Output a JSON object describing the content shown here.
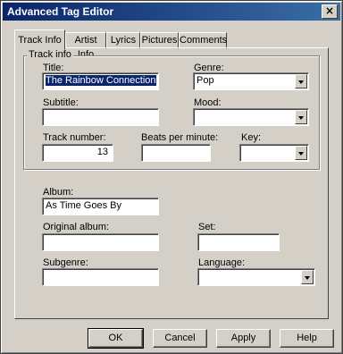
{
  "window": {
    "title": "Advanced Tag Editor",
    "close_glyph": "×"
  },
  "tabs": [
    {
      "label": "Track Info",
      "active": true
    },
    {
      "label": "Artist Info",
      "active": false
    },
    {
      "label": "Lyrics",
      "active": false
    },
    {
      "label": "Pictures",
      "active": false
    },
    {
      "label": "Comments",
      "active": false
    }
  ],
  "track_info_group": {
    "label": "Track info",
    "title": {
      "label": "Title:",
      "value": "The Rainbow Connection"
    },
    "genre": {
      "label": "Genre:",
      "value": "Pop"
    },
    "subtitle": {
      "label": "Subtitle:",
      "value": ""
    },
    "mood": {
      "label": "Mood:",
      "value": ""
    },
    "track_number": {
      "label": "Track number:",
      "value": "13"
    },
    "bpm": {
      "label": "Beats per minute:",
      "value": ""
    },
    "key": {
      "label": "Key:",
      "value": ""
    }
  },
  "album_section": {
    "album": {
      "label": "Album:",
      "value": "As Time Goes By"
    },
    "original_album": {
      "label": "Original album:",
      "value": ""
    },
    "set": {
      "label": "Set:",
      "value": ""
    },
    "subgenre": {
      "label": "Subgenre:",
      "value": ""
    },
    "language": {
      "label": "Language:",
      "value": ""
    }
  },
  "buttons": {
    "ok": "OK",
    "cancel": "Cancel",
    "apply": "Apply",
    "help": "Help"
  }
}
